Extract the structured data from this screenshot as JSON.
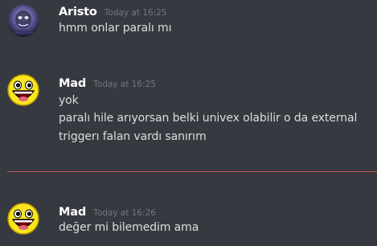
{
  "messages": [
    {
      "username": "Aristo",
      "timestamp": "Today at 16:25",
      "avatar_icon": "dark-face-avatar-icon",
      "lines": [
        "hmm onlar paralı mı"
      ]
    },
    {
      "username": "Mad",
      "timestamp": "Today at 16:25",
      "avatar_icon": "awesome-smiley-face-icon",
      "lines": [
        "yok",
        "paralı hile arıyorsan belki univex olabilir o da external",
        "triggerı falan vardı sanırım"
      ]
    },
    {
      "username": "Mad",
      "timestamp": "Today at 16:26",
      "avatar_icon": "awesome-smiley-face-icon",
      "lines": [
        "değer mi bilemedim ama"
      ]
    }
  ],
  "colors": {
    "background": "#36393f",
    "username": "#ffffff",
    "timestamp": "#72767d",
    "message_text": "#dcddde",
    "new_messages_divider": "#c2515a"
  }
}
